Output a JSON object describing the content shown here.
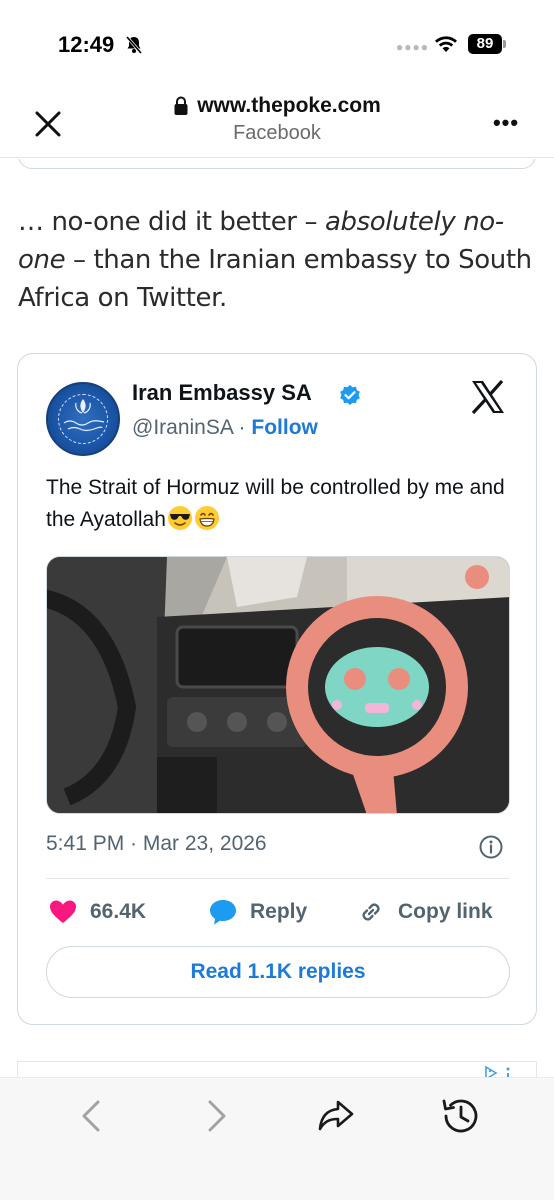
{
  "status_bar": {
    "time": "12:49",
    "battery": "89"
  },
  "browser": {
    "url": "www.thepoke.com",
    "source": "Facebook"
  },
  "article": {
    "part1": "… no-one did it better – ",
    "emphasis": "absolutely no-one",
    "part2": " – than the Iranian embassy to South Africa on Twitter."
  },
  "tweet": {
    "author_name": "Iran Embassy SA",
    "handle": "@IraninSA",
    "separator": " · ",
    "follow_label": "Follow",
    "text": "The Strait of Hormuz will be controlled by me and the Ayatollah",
    "emojis": [
      "sunglasses-emoji",
      "grinning-emoji"
    ],
    "timestamp": "5:41 PM · Mar 23, 2026",
    "likes": "66.4K",
    "reply_label": "Reply",
    "copy_link_label": "Copy link",
    "read_replies_label": "Read 1.1K replies"
  },
  "colors": {
    "accent_blue": "#1d7bd7",
    "like_pink": "#f91880",
    "verified_blue": "#1d9bf0"
  },
  "icons": {
    "close": "close-icon",
    "more": "more-icon",
    "lock": "lock-icon",
    "x_logo": "x-logo-icon",
    "info": "info-icon",
    "like": "heart-icon",
    "reply": "speech-bubble-icon",
    "copy": "link-icon",
    "back": "chevron-left-icon",
    "forward": "chevron-right-icon",
    "share": "share-icon",
    "history": "history-icon"
  }
}
